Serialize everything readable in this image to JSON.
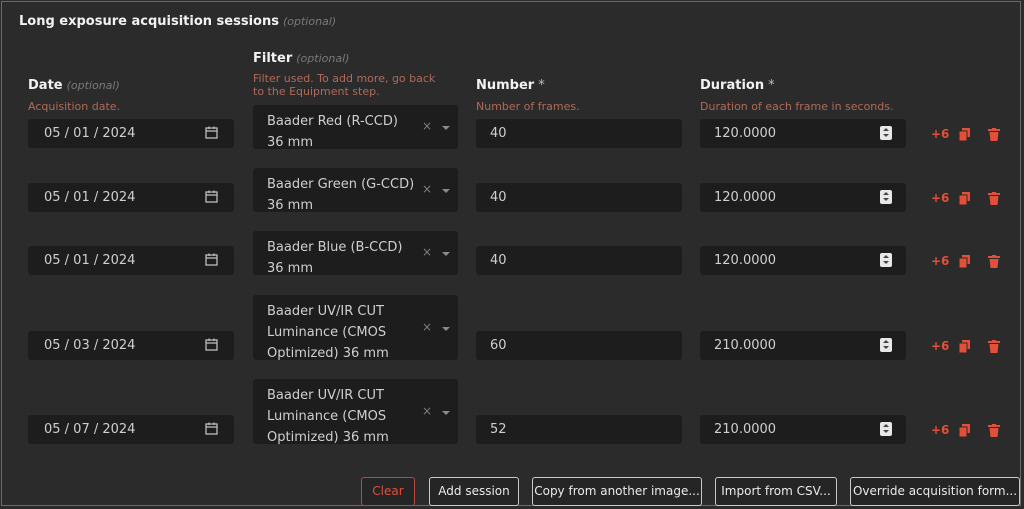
{
  "section": {
    "title": "Long exposure acquisition sessions",
    "title_optional": "(optional)"
  },
  "columns": {
    "date": {
      "label": "Date",
      "optional": "(optional)",
      "help": "Acquisition date."
    },
    "filter": {
      "label": "Filter",
      "optional": "(optional)",
      "help": "Filter used. To add more, go back to the Equipment step."
    },
    "number": {
      "label": "Number",
      "required": "*",
      "help": "Number of frames."
    },
    "duration": {
      "label": "Duration",
      "required": "*",
      "help": "Duration of each frame in seconds."
    }
  },
  "rows": [
    {
      "date": "05 / 01 / 2024",
      "filter": "Baader Red (R-CCD) 36 mm",
      "number": "40",
      "duration": "120.0000",
      "plus": "+6"
    },
    {
      "date": "05 / 01 / 2024",
      "filter": "Baader Green (G-CCD) 36 mm",
      "number": "40",
      "duration": "120.0000",
      "plus": "+6"
    },
    {
      "date": "05 / 01 / 2024",
      "filter": "Baader Blue (B-CCD) 36 mm",
      "number": "40",
      "duration": "120.0000",
      "plus": "+6"
    },
    {
      "date": "05 / 03 / 2024",
      "filter": "Baader UV/IR CUT Luminance (CMOS Optimized) 36 mm",
      "number": "60",
      "duration": "210.0000",
      "plus": "+6"
    },
    {
      "date": "05 / 07 / 2024",
      "filter": "Baader UV/IR CUT Luminance (CMOS Optimized) 36 mm",
      "number": "52",
      "duration": "210.0000",
      "plus": "+6"
    }
  ],
  "clear_symbol": "×",
  "buttons": {
    "clear": "Clear",
    "add_session": "Add session",
    "copy": "Copy from another image...",
    "import_csv": "Import from CSV...",
    "override": "Override acquisition form..."
  },
  "colors": {
    "accent": "#e0503a",
    "help_text": "#b06a58",
    "input_bg": "#1d1d1d",
    "background": "#2b2b2b"
  }
}
